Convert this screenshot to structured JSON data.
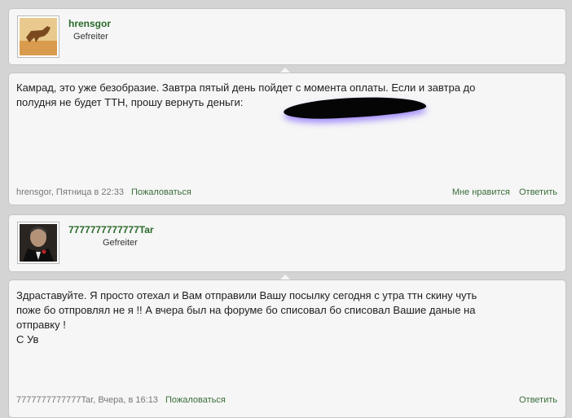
{
  "posts": [
    {
      "username": "hrensgor",
      "rank": "Gefreiter",
      "avatar_icon": "desert-animal-avatar",
      "text": "Камрад, это уже безобразие. Завтра пятый день пойдет с момента оплаты. Если и завтра до\nполудня не будет ТТН, прошу вернуть деньги:",
      "meta_author": "hrensgor",
      "meta_time": ", Пятница в 22:33",
      "report_label": "Пожаловаться",
      "like_label": "Мне нравится",
      "reply_label": "Ответить"
    },
    {
      "username": "7777777777777Tar",
      "rank": "Gefreiter",
      "avatar_icon": "godfather-avatar",
      "text": "Здраставуйте. Я просто отехал и Вам отправили Вашу посылку сегодня с утра ттн скину чуть\nпоже бо отпровлял не я !! А вчера был на форуме бо списовал бо списовал Вашие даные на\nотправку !\nС Ув",
      "meta_author": "7777777777777Tar",
      "meta_time": ", Вчера, в 16:13",
      "report_label": "Пожаловаться",
      "reply_label": "Ответить"
    }
  ],
  "colors": {
    "link": "#3a6d3a",
    "username": "#2b6a2b",
    "background": "#d4d4d4"
  }
}
